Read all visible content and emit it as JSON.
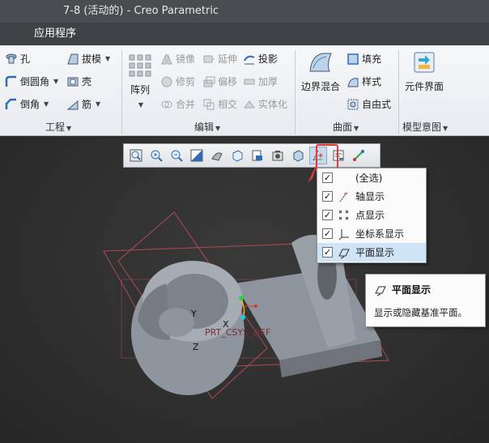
{
  "window": {
    "title": "7-8 (活动的) - Creo Parametric"
  },
  "menubar": {
    "app_menu": "应用程序"
  },
  "ribbon": {
    "engineering": {
      "hole": "孔",
      "draft": "拔模",
      "round": "倒圆角",
      "shell": "壳",
      "chamfer": "倒角",
      "rib": "筋",
      "group_label": "工程"
    },
    "editing": {
      "pattern": "阵列",
      "mirror": "镜像",
      "extend": "延伸",
      "project": "投影",
      "trim": "修剪",
      "offset": "偏移",
      "thicken": "加厚",
      "merge": "合并",
      "intersect": "相交",
      "solidify": "实体化",
      "group_label": "编辑"
    },
    "surfaces": {
      "boundary_blend": "边界混合",
      "fill": "填充",
      "style": "样式",
      "freestyle": "自由式",
      "group_label": "曲面"
    },
    "model_intent": {
      "component_interface": "元件界面",
      "group_label": "模型意图"
    }
  },
  "dropdown": {
    "items": [
      {
        "label": "(全选)",
        "checked": true
      },
      {
        "label": "轴显示",
        "checked": true
      },
      {
        "label": "点显示",
        "checked": true
      },
      {
        "label": "坐标系显示",
        "checked": true
      },
      {
        "label": "平面显示",
        "checked": true
      }
    ]
  },
  "tooltip": {
    "title": "平面显示",
    "description": "显示或隐藏基准平面。"
  },
  "model": {
    "csys_label": "PRT_CSYS_DEF",
    "axis_x": "X",
    "axis_y": "Y",
    "axis_z": "Z"
  },
  "icons": [
    "hole-icon",
    "draft-icon",
    "round-icon",
    "shell-icon",
    "chamfer-icon",
    "rib-icon",
    "pattern-icon",
    "mirror-icon",
    "extend-icon",
    "project-icon",
    "trim-icon",
    "offset-icon",
    "thicken-icon",
    "merge-icon",
    "intersect-icon",
    "solidify-icon",
    "boundary-blend-icon",
    "fill-icon",
    "style-icon",
    "freestyle-icon",
    "component-interface-icon",
    "zoom-fit-icon",
    "zoom-in-icon",
    "zoom-out-icon",
    "repaint-icon",
    "display-style-icon",
    "saved-views-icon",
    "section-icon",
    "view-manager-icon",
    "perspective-icon",
    "datum-display-filter-icon",
    "annotation-display-icon",
    "spin-center-icon"
  ],
  "colors": {
    "highlight_red": "#e23a3a",
    "selected_row": "#cfe4f6",
    "model_gray": "#8e949d",
    "datum_plane": "#b04a55"
  }
}
